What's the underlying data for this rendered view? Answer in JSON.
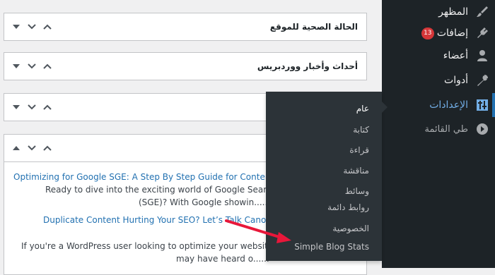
{
  "widgets": [
    {
      "title": "الحالة الصحية للموقع"
    },
    {
      "title": "أحداث وأخبار ووردبريس"
    },
    {
      "title": ""
    },
    {
      "title": ""
    }
  ],
  "news_feed": {
    "items": [
      {
        "title": "Optimizing for Google SGE: A Step By Step Guide for Content C",
        "excerpt_1": "Ready to dive into the exciting world of Google Search",
        "excerpt_2": "(SGE)? With Google showin......"
      },
      {
        "title": "Duplicate Content Hurting Your SEO? Let’s Talk Canonic",
        "excerpt_1": "If you're a WordPress user looking to optimize your website f",
        "excerpt_2": "may have heard o......"
      }
    ]
  },
  "sidebar": {
    "items": [
      {
        "label": "المظهر",
        "icon": "paintbrush-icon"
      },
      {
        "label": "إضافات",
        "icon": "plugins-icon",
        "badge": "13"
      },
      {
        "label": "أعضاء",
        "icon": "users-icon"
      },
      {
        "label": "أدوات",
        "icon": "wrench-icon"
      },
      {
        "label": "الإعدادات",
        "icon": "settings-icon",
        "active": true
      },
      {
        "label": "طي القائمة",
        "icon": "collapse-icon"
      }
    ]
  },
  "settings_submenu": {
    "items": [
      {
        "label": "عام"
      },
      {
        "label": "كتابة"
      },
      {
        "label": "قراءة"
      },
      {
        "label": "مناقشة"
      },
      {
        "label": "وسائط"
      },
      {
        "label": "روابط دائمة"
      },
      {
        "label": "الخصوصية"
      },
      {
        "label": "Simple Blog Stats"
      }
    ]
  },
  "colors": {
    "sidebar_bg": "#1d2327",
    "flyout_bg": "#2c3338",
    "accent": "#72aee6",
    "link": "#2271b1",
    "badge": "#d63638",
    "annotation_arrow": "#e8173a"
  }
}
